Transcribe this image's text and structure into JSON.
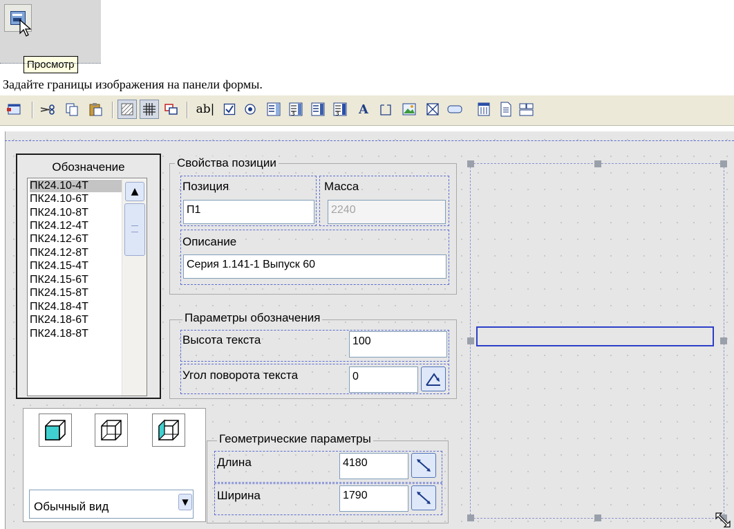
{
  "tooltip": {
    "text": "Просмотр"
  },
  "instruction": "Задайте границы изображения на панели формы.",
  "toolbar": {
    "icons": [
      "form-icon",
      "cut-icon",
      "copy-icon",
      "paste-icon",
      "hatch-icon",
      "grid-icon",
      "tab-order-icon",
      "textbox-icon",
      "checkbox-icon",
      "radio-icon",
      "listbox-icon",
      "combobox-icon",
      "grid-list-icon",
      "table-icon",
      "label-icon",
      "frame-icon",
      "image-icon",
      "picture-frame-icon",
      "button-icon",
      "calendar-icon",
      "document-icon",
      "multipage-icon"
    ],
    "textbox_glyph": "ab|",
    "label_glyph": "A"
  },
  "list": {
    "header": "Обозначение",
    "items": [
      "ПК24.10-4Т",
      "ПК24.10-6Т",
      "ПК24.10-8Т",
      "ПК24.12-4Т",
      "ПК24.12-6Т",
      "ПК24.12-8Т",
      "ПК24.15-4Т",
      "ПК24.15-6Т",
      "ПК24.15-8Т",
      "ПК24.18-4Т",
      "ПК24.18-6Т",
      "ПК24.18-8Т"
    ],
    "selected_index": 0
  },
  "properties": {
    "title": "Свойства позиции",
    "position_label": "Позиция",
    "position_value": "П1",
    "mass_label": "Масса",
    "mass_value": "2240",
    "description_label": "Описание",
    "description_value": "Серия 1.141-1 Выпуск 60"
  },
  "params": {
    "title": "Параметры обозначения",
    "text_height_label": "Высота текста",
    "text_height_value": "100",
    "text_angle_label": "Угол поворота текста",
    "text_angle_value": "0"
  },
  "geometry": {
    "title": "Геометрические параметры",
    "length_label": "Длина",
    "length_value": "4180",
    "width_label": "Ширина",
    "width_value": "1790"
  },
  "view": {
    "select_value": "Обычный вид",
    "cube_buttons": [
      "cube-shaded-icon",
      "cube-wireframe-icon",
      "cube-side-icon"
    ]
  },
  "colors": {
    "accent": "#2c3fc8",
    "cube_fill": "#40d0d0",
    "tooltip_bg": "#ffffe1"
  }
}
